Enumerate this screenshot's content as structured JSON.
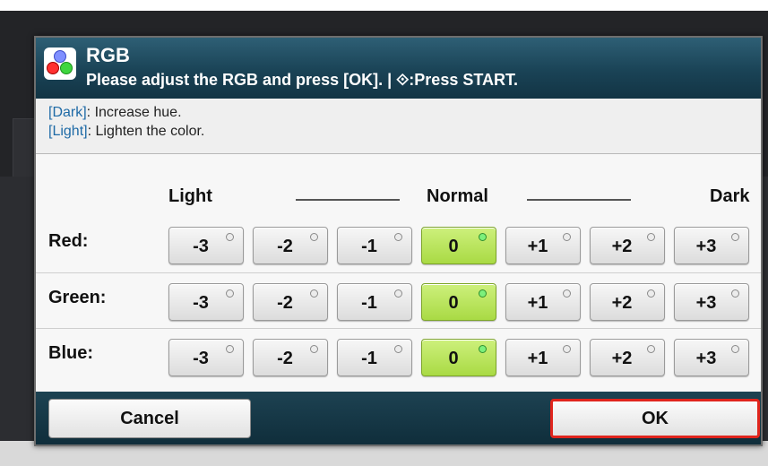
{
  "dialog": {
    "title": "RGB",
    "subtitle": "Please adjust the RGB and press [OK]. | ⟐:Press START.",
    "icon": "rgb-color-icon"
  },
  "info": {
    "dark_key": "[Dark]",
    "dark_text": ": Increase hue.",
    "light_key": "[Light]",
    "light_text": ": Lighten the color."
  },
  "scale": {
    "light": "Light",
    "normal": "Normal",
    "dark": "Dark"
  },
  "levels": [
    "-3",
    "-2",
    "-1",
    "0",
    "+1",
    "+2",
    "+3"
  ],
  "rows": [
    {
      "label": "Red:",
      "selected": "0"
    },
    {
      "label": "Green:",
      "selected": "0"
    },
    {
      "label": "Blue:",
      "selected": "0"
    }
  ],
  "footer": {
    "cancel_label": "Cancel",
    "ok_label": "OK"
  },
  "colors": {
    "title_bar": "#1a4356",
    "selected": "#b6e254",
    "info_key": "#1e6aa6",
    "ok_border": "#e0251d"
  }
}
